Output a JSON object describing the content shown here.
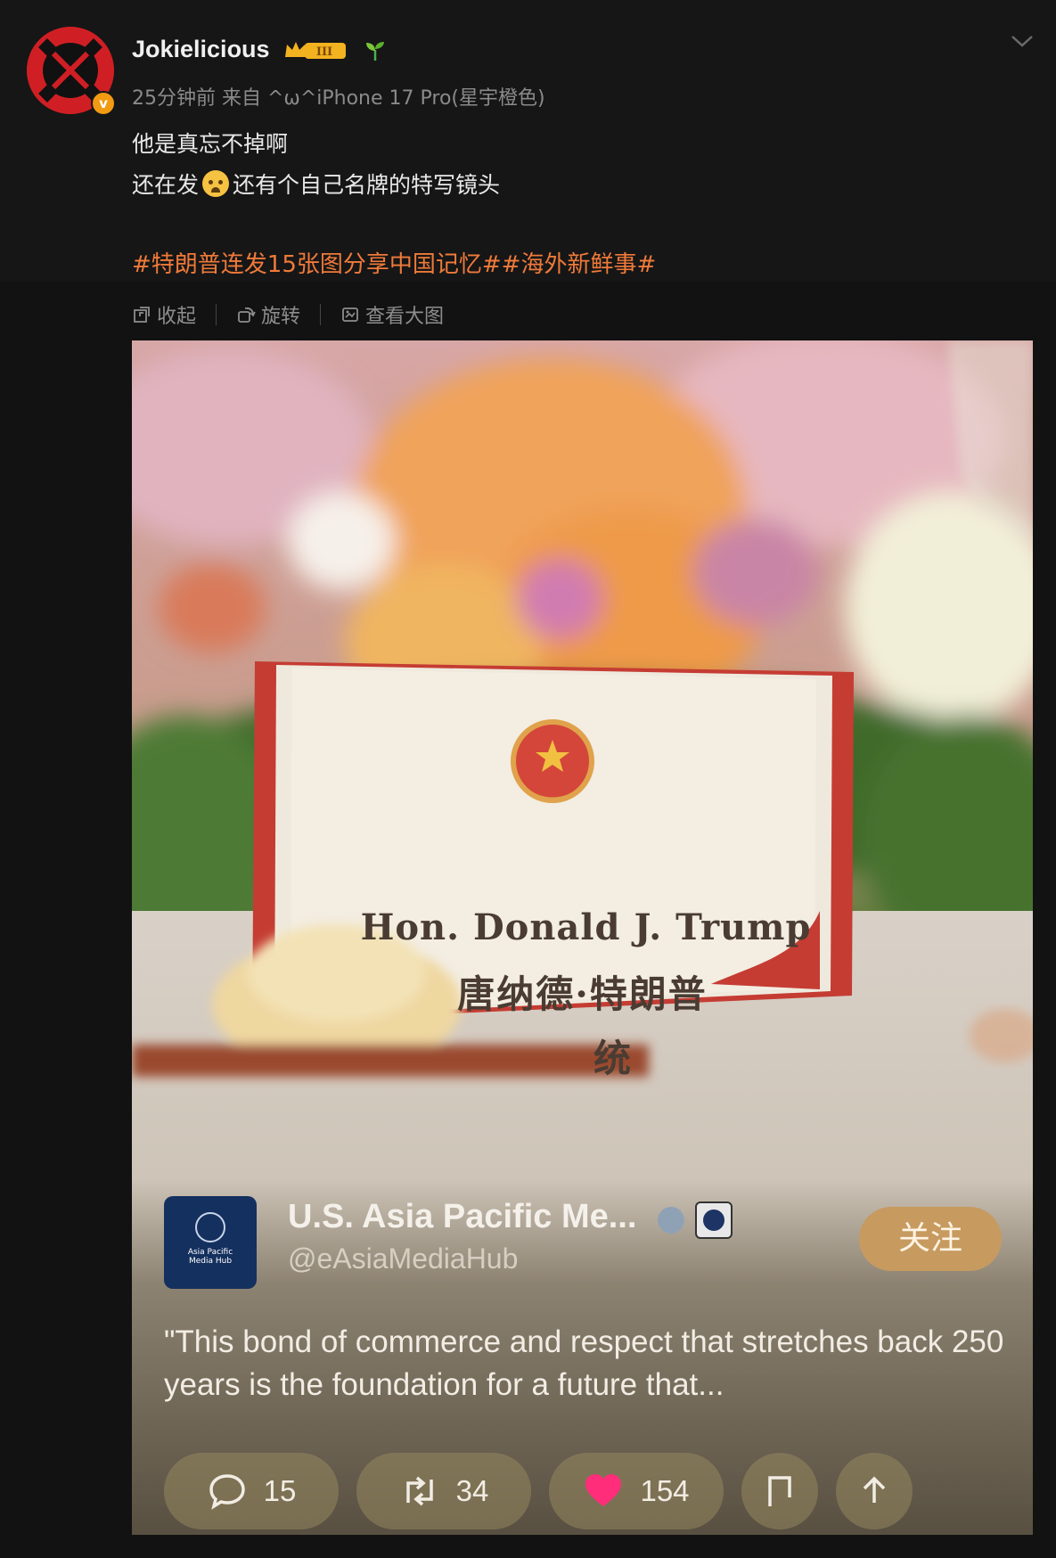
{
  "post": {
    "username": "Jokielicious",
    "level_badge": "III",
    "meta": "25分钟前  来自 ^ω^iPhone 17 Pro(星宇橙色)",
    "text_line1": "他是真忘不掉啊",
    "text_line2a": "还在发",
    "text_line2b": "还有个自己名牌的特写镜头",
    "hashtags": "#特朗普连发15张图分享中国记忆##海外新鲜事#",
    "verified_letter": "v"
  },
  "toolbar": {
    "collapse_label": "收起",
    "rotate_label": "旋转",
    "view_large_label": "查看大图"
  },
  "image": {
    "nameplate_en": "Hon. Donald J. Trump",
    "nameplate_zh": "唐纳德·特朗普",
    "nameplate_zh2": "统",
    "account_name": "U.S. Asia Pacific Me...",
    "account_handle": "@eAsiaMediaHub",
    "logo_line1": "Asia Pacific",
    "logo_line2": "Media Hub",
    "follow_label": "关注",
    "quote": "\"This bond of commerce and respect that stretches back 250 years is the foundation for a future that...",
    "replies": "15",
    "reposts": "34",
    "likes": "154",
    "colors": {
      "like": "#ff2d7a",
      "hashtag": "#ef7a3a",
      "follow_bg": "#c79a60"
    }
  }
}
